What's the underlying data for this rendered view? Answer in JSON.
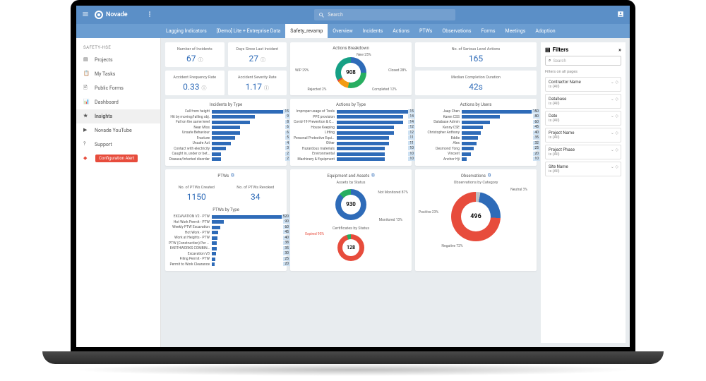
{
  "brand": "Novade",
  "search": {
    "placeholder": "Search"
  },
  "tabs": [
    "Lagging Indicators",
    "[Demo] Lite + Entreprise Data",
    "Safety_revamp",
    "Overview",
    "Incidents",
    "Actions",
    "PTWs",
    "Observations",
    "Forms",
    "Meetings",
    "Adoption"
  ],
  "activeTab": 2,
  "sidebar": {
    "heading": "SAFETY-HSE",
    "items": [
      {
        "icon": "folder",
        "label": "Projects"
      },
      {
        "icon": "clip",
        "label": "My Tasks"
      },
      {
        "icon": "form",
        "label": "Public Forms"
      },
      {
        "icon": "chart",
        "label": "Dashboard"
      },
      {
        "icon": "star",
        "label": "Insights",
        "active": true
      },
      {
        "icon": "yt",
        "label": "Novade YouTube"
      },
      {
        "icon": "help",
        "label": "Support"
      }
    ],
    "alert": {
      "icon": "warn",
      "label": "Configuration Alert"
    }
  },
  "kpi_groups": {
    "incidents": [
      {
        "label": "Number of Incidents",
        "value": "67"
      },
      {
        "label": "Days Since Last Incident",
        "value": "27"
      },
      {
        "label": "Accident Frequency Rate",
        "value": "0.33"
      },
      {
        "label": "Accident Severity Rate",
        "value": "1.17"
      }
    ],
    "actions": {
      "title": "Actions Breakdown",
      "center": "908",
      "segments": [
        {
          "label": "New 25%",
          "color": "#2E6BB8",
          "pct": 25
        },
        {
          "label": "Closed 28%",
          "color": "#27AE60",
          "pct": 28
        },
        {
          "label": "Completed 12%",
          "color": "#F39C12",
          "pct": 12
        },
        {
          "label": "Rejected 2%",
          "color": "#E74C3C",
          "pct": 2
        },
        {
          "label": "WIP 29%",
          "color": "#16A085",
          "pct": 29
        }
      ]
    },
    "serious": {
      "label": "No. of Serious Level Actions",
      "value": "165"
    },
    "median": {
      "label": "Median Completion Duration",
      "value": "42s"
    }
  },
  "bar_charts": {
    "incidents_by_type": {
      "title": "Incidents by Type",
      "max": 15,
      "rows": [
        [
          "Fall from height",
          15
        ],
        [
          "Hit by moving/falling obj.",
          9
        ],
        [
          "Fall on the same level",
          8
        ],
        [
          "Near Miss",
          6
        ],
        [
          "Unsafe Behaviour",
          6
        ],
        [
          "Fracture",
          5
        ],
        [
          "Unsafe Act",
          4
        ],
        [
          "Contact with electricity",
          3
        ],
        [
          "Caught in, under or bet…",
          2
        ],
        [
          "Disease/Infected disorder",
          2
        ]
      ]
    },
    "actions_by_type": {
      "title": "Actions by Type",
      "max": 15,
      "rows": [
        [
          "Improper usage of Tools",
          15
        ],
        [
          "PPE provision",
          14
        ],
        [
          "Covid-19 Prevention & Con…",
          14
        ],
        [
          "House Keeping",
          12
        ],
        [
          "Lifting",
          12
        ],
        [
          "Personal Protective Equipm…",
          11
        ],
        [
          "Other",
          11
        ],
        [
          "Hazardous materials",
          10
        ],
        [
          "Environmental",
          10
        ],
        [
          "Machinery & Equipment",
          10
        ]
      ]
    },
    "actions_by_users": {
      "title": "Actions by Users",
      "max": 150,
      "rows": [
        [
          "Jaap Chen",
          150
        ],
        [
          "Karen CSS",
          80
        ],
        [
          "Database Admin",
          60
        ],
        [
          "Kenny CSE",
          45
        ],
        [
          "Christopher Anthony",
          40
        ],
        [
          "Eddie",
          35
        ],
        [
          "Alex",
          32
        ],
        [
          "Desmond Yong",
          25
        ],
        [
          "Vincent",
          20
        ],
        [
          "Anchor Hji",
          10
        ]
      ]
    },
    "ptws_by_type": {
      "title": "PTWs by Type",
      "max": 520,
      "rows": [
        [
          "EXCAVATION V2 - PTW",
          520
        ],
        [
          "Hot Work Permit - PTW",
          90
        ],
        [
          "Weekly PTW Excavation",
          60
        ],
        [
          "Hot Work - PTW",
          45
        ],
        [
          "Work at Heights - PTW",
          40
        ],
        [
          "PTW (Construction) Per H…",
          38
        ],
        [
          "EARTHWORKS COMBIN…",
          35
        ],
        [
          "Excavation V3",
          30
        ],
        [
          "Filing Permit - PTW",
          25
        ],
        [
          "Permit to Work Clearance",
          20
        ]
      ]
    }
  },
  "ptws": {
    "title": "PTWs",
    "created": {
      "label": "No. of PTWs Created",
      "value": "1150"
    },
    "revoked": {
      "label": "No. of PTWs Revoked",
      "value": "34"
    }
  },
  "assets": {
    "title": "Equipment and Assets",
    "sub": "Assets by Status",
    "center": "930",
    "segments": [
      {
        "label": "Not Monitored 87%",
        "color": "#2E6BB8"
      },
      {
        "label": "Monitored 13%",
        "color": "#27AE60"
      }
    ],
    "cert": {
      "title": "Certificates by Status",
      "center": "128",
      "label": "Expired 95%",
      "color": "#E74C3C"
    }
  },
  "observations": {
    "title": "Observations",
    "sub": "Observations by Category",
    "center": "496",
    "segments": [
      {
        "label": "Neutral 3%",
        "color": "#BDC3C7"
      },
      {
        "label": "Positive 23%",
        "color": "#2E6BB8"
      },
      {
        "label": "Negative 72%",
        "color": "#E74C3C"
      }
    ]
  },
  "filters": {
    "title": "Filters",
    "search_ph": "Search",
    "note": "Filters on all pages",
    "items": [
      {
        "name": "Contractor Name",
        "value": "is (All)"
      },
      {
        "name": "Database",
        "value": "is (All)"
      },
      {
        "name": "Date",
        "value": "is (All)"
      },
      {
        "name": "Project Name",
        "value": "is (All)"
      },
      {
        "name": "Project Phase",
        "value": "is (All)"
      },
      {
        "name": "Site Name",
        "value": "is (All)"
      }
    ]
  }
}
